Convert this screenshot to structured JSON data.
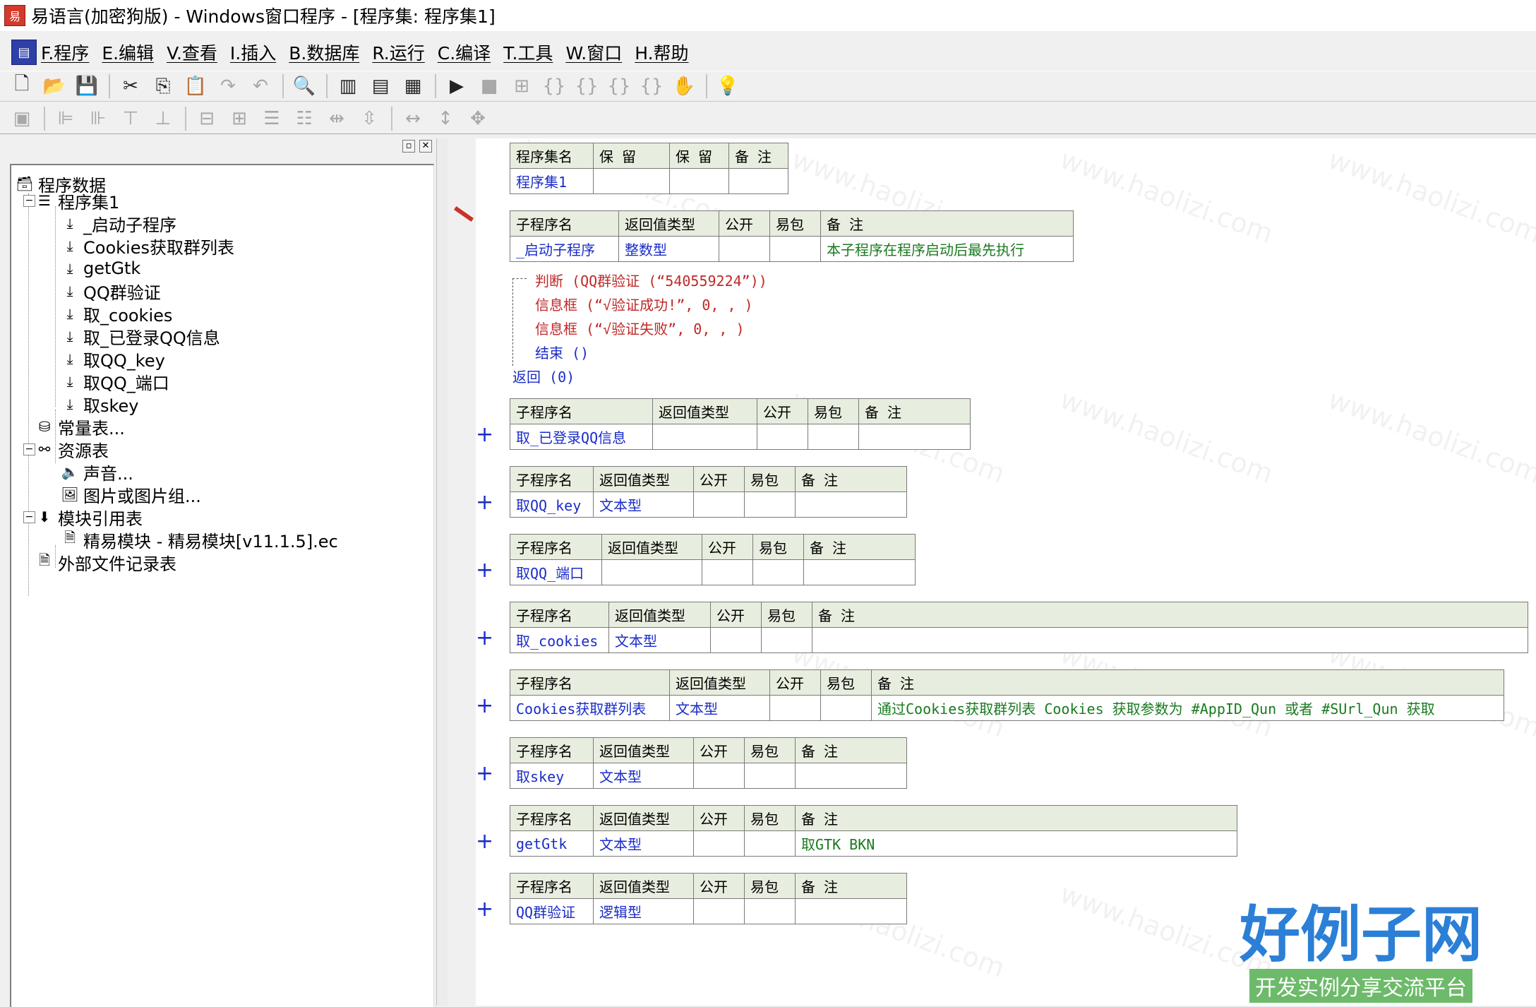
{
  "window": {
    "title": "易语言(加密狗版) - Windows窗口程序 - [程序集: 程序集1]"
  },
  "menu": [
    "F.程序",
    "E.编辑",
    "V.查看",
    "I.插入",
    "B.数据库",
    "R.运行",
    "C.编译",
    "T.工具",
    "W.窗口",
    "H.帮助"
  ],
  "tree": {
    "root": "程序数据",
    "module": "程序集1",
    "subs": [
      "_启动子程序",
      "Cookies获取群列表",
      "getGtk",
      "QQ群验证",
      "取_cookies",
      "取_已登录QQ信息",
      "取QQ_key",
      "取QQ_端口",
      "取skey"
    ],
    "constants": "常量表...",
    "resources": "资源表",
    "sound": "声音...",
    "images": "图片或图片组...",
    "modref": "模块引用表",
    "module_item": "精易模块 - 精易模块[v11.1.5].ec",
    "external": "外部文件记录表"
  },
  "assembly_table": {
    "headers": [
      "程序集名",
      "保 留",
      "保 留",
      "备 注"
    ],
    "values": [
      "程序集1",
      "",
      "",
      ""
    ]
  },
  "sub_headers": [
    "子程序名",
    "返回值类型",
    "公开",
    "易包",
    "备 注"
  ],
  "subroutines": [
    {
      "name": "_启动子程序",
      "type": "整数型",
      "note": "本子程序在程序启动后最先执行"
    },
    {
      "name": "取_已登录QQ信息",
      "type": "",
      "note": ""
    },
    {
      "name": "取QQ_key",
      "type": "文本型",
      "note": ""
    },
    {
      "name": "取QQ_端口",
      "type": "",
      "note": ""
    },
    {
      "name": "取_cookies",
      "type": "文本型",
      "note": ""
    },
    {
      "name": "Cookies获取群列表",
      "type": "文本型",
      "note": "通过Cookies获取群列表  Cookies 获取参数为  #AppID_Qun 或者 #SUrl_Qun 获取"
    },
    {
      "name": "取skey",
      "type": "文本型",
      "note": ""
    },
    {
      "name": "getGtk",
      "type": "文本型",
      "note": "取GTK BKN"
    },
    {
      "name": "QQ群验证",
      "type": "逻辑型",
      "note": ""
    }
  ],
  "code": {
    "l1_kw": "判断",
    "l1_rest": " (QQ群验证 (“540559224”))",
    "l2_kw": "信息框",
    "l2_rest": " (“√验证成功!”, 0, , )",
    "l3_kw": "信息框",
    "l3_rest": " (“√验证失败”, 0, , )",
    "l4_kw": "结束",
    "l4_rest": " ()",
    "l5_kw": "返回",
    "l5_rest": " (0)"
  },
  "plus_symbol": "+",
  "watermark": "www.haolizi.com",
  "brand": {
    "main": "好例子网",
    "sub": "开发实例分享交流平台"
  }
}
